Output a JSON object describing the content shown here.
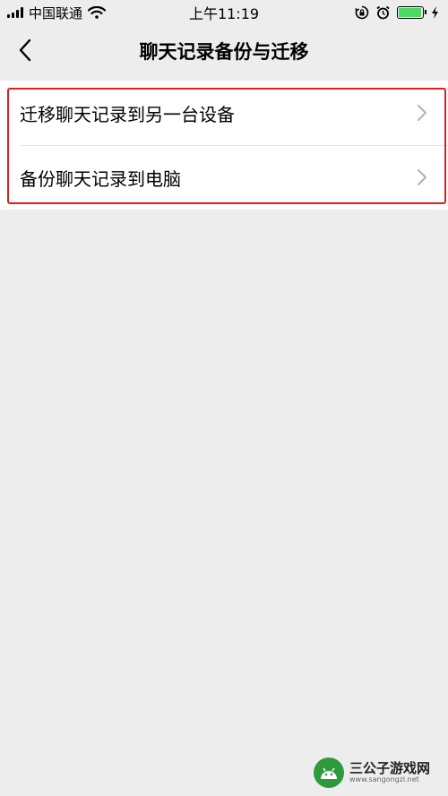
{
  "status_bar": {
    "carrier": "中国联通",
    "time": "上午11:19",
    "icons": [
      "signal-icon",
      "wifi-icon",
      "rotation-lock-icon",
      "alarm-icon",
      "battery-icon",
      "charging-icon"
    ],
    "battery_level": 0.95,
    "battery_color": "#4cd964"
  },
  "nav": {
    "title": "聊天记录备份与迁移",
    "back_icon": "chevron-left-icon"
  },
  "menu": {
    "items": [
      {
        "label": "迁移聊天记录到另一台设备",
        "icon": "chevron-right-icon"
      },
      {
        "label": "备份聊天记录到电脑",
        "icon": "chevron-right-icon"
      }
    ]
  },
  "colors": {
    "background": "#ededed",
    "highlight": "#e02020",
    "chevron": "#b2b2b2"
  },
  "watermark": {
    "name": "三公子游戏网",
    "url": "www.sangongzi.net"
  }
}
